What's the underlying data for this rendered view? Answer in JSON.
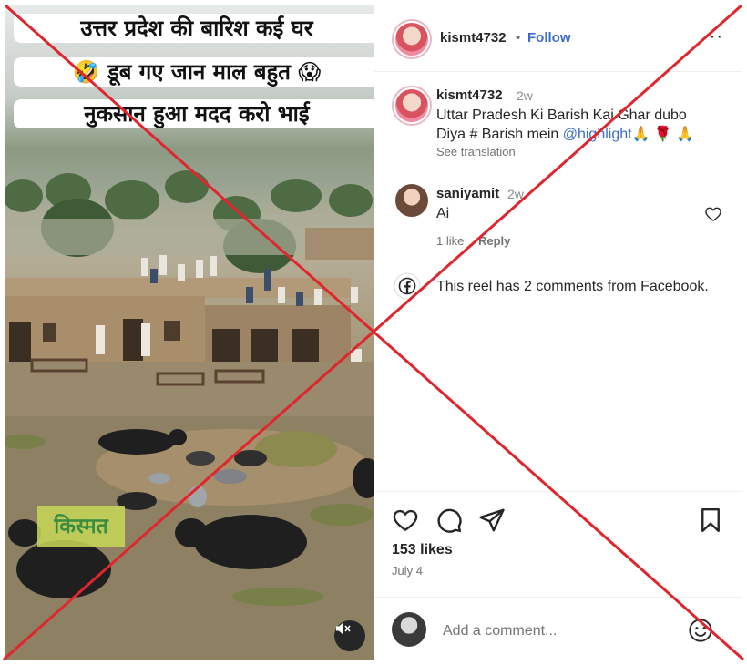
{
  "video": {
    "caption_lines": [
      "उत्तर प्रदेश की बारिश कई घर",
      "🤣 डूब गए जान माल बहुत 😱",
      "नुकसान हुआ मदद करो भाई"
    ],
    "watermark": "किस्मत",
    "mute_icon": "speaker-muted-icon"
  },
  "header": {
    "username": "kismt4732",
    "separator": "•",
    "follow_label": "Follow",
    "more_label": "···"
  },
  "post": {
    "username": "kismt4732",
    "time": "2w",
    "caption_line1": "Uttar Pradesh Ki Barish Kai Ghar dubo",
    "caption_line2_prefix": "Diya # Barish mein ",
    "mention": "@highlight",
    "emojis": "🙏 🌹 🙏",
    "see_translation": "See translation"
  },
  "comments": [
    {
      "username": "saniyamit",
      "time": "2w",
      "text": "Ai",
      "likes": "1 like",
      "reply_label": "Reply"
    }
  ],
  "facebook_note": "This reel has 2 comments from Facebook.",
  "stats": {
    "likes": "153 likes",
    "date": "July 4"
  },
  "comment_box": {
    "placeholder": "Add a comment..."
  },
  "colors": {
    "link": "#3c6cc7",
    "cross": "#e0262d",
    "muted": "#737373"
  }
}
